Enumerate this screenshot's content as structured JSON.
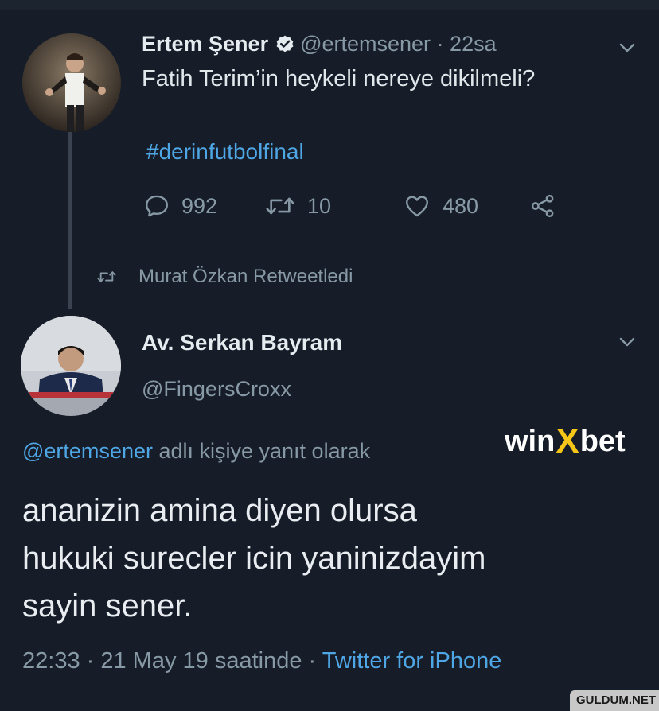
{
  "tweet": {
    "display_name": "Ertem Şener",
    "handle": "@ertemsener",
    "time_sep": " · ",
    "time": "22sa",
    "text": "Fatih Terim’in heykeli nereye dikilmeli?",
    "hashtag": "#derinfutbolfinal",
    "replies": "992",
    "retweets": "10",
    "likes": "480"
  },
  "retweet_note": "Murat Özkan Retweetledi",
  "reply": {
    "display_name": "Av. Serkan Bayram",
    "handle": "@FingersCroxx",
    "mention": "@ertemsener",
    "reply_to_suffix": " adlı kişiye yanıt olarak",
    "text_lines": [
      "ananizin amina diyen olursa",
      "hukuki surecler icin yaninizdayim",
      "sayin sener."
    ],
    "timestamp": "22:33 · 21 May 19 saatinde · ",
    "client": "Twitter for iPhone"
  },
  "watermark": {
    "part1": "win",
    "part2": "X",
    "part3": "bet"
  },
  "site_badge": "GULDUM.NET",
  "colors": {
    "background": "#161d28",
    "link": "#4fa6e4",
    "muted": "#8899a6",
    "verified": "#e6ebf0",
    "watermark_accent": "#f5c518"
  },
  "icons": {
    "verified": "verified-badge-icon",
    "reply": "comment-bubble-icon",
    "retweet": "retweet-arrows-icon",
    "like": "heart-icon",
    "share": "share-icon",
    "more": "chevron-down-icon"
  }
}
